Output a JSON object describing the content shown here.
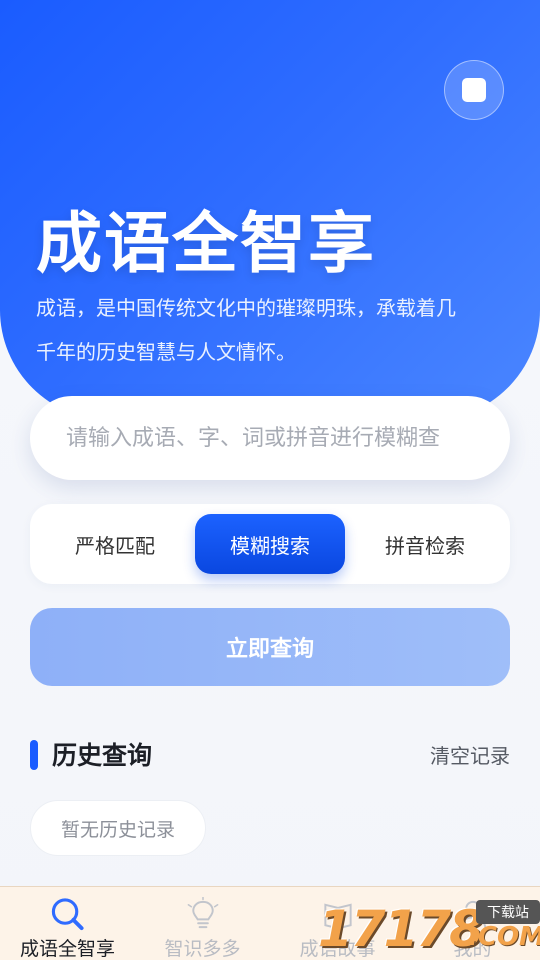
{
  "hero": {
    "title": "成语全智享",
    "description": "成语，是中国传统文化中的璀璨明珠，承载着几千年的历史智慧与人文情怀。",
    "menu_icon": "square-icon"
  },
  "search": {
    "placeholder": "请输入成语、字、词或拼音进行模糊查",
    "value": ""
  },
  "modes": {
    "items": [
      {
        "label": "严格匹配",
        "active": false
      },
      {
        "label": "模糊搜索",
        "active": true
      },
      {
        "label": "拼音检索",
        "active": false
      }
    ]
  },
  "query_button": {
    "label": "立即查询"
  },
  "history": {
    "title": "历史查询",
    "clear_label": "清空记录",
    "empty_text": "暂无历史记录"
  },
  "bottom_nav": {
    "items": [
      {
        "label": "成语全智享",
        "icon": "search-icon",
        "active": true
      },
      {
        "label": "智识多多",
        "icon": "lightbulb-icon",
        "active": false
      },
      {
        "label": "成语故事",
        "icon": "book-icon",
        "active": false
      },
      {
        "label": "我的",
        "icon": "user-icon",
        "active": false
      }
    ]
  },
  "watermark": {
    "number": "17178",
    "tag": "下载站",
    "suffix": ".COM"
  },
  "colors": {
    "primary": "#1a5cff",
    "query_button": "#9ab9f8",
    "nav_background": "#fdf3e8"
  }
}
